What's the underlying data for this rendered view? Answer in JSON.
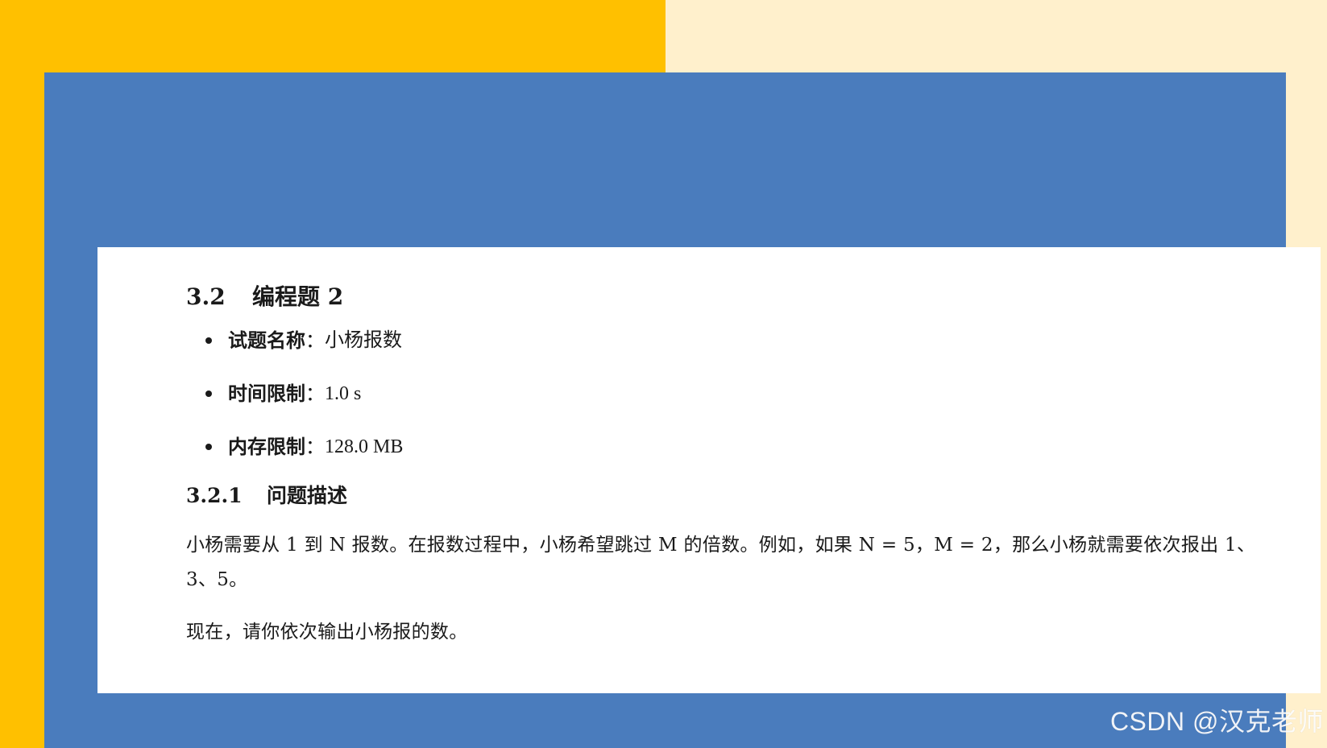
{
  "section": {
    "number": "3.2",
    "title": "编程题 2"
  },
  "meta": [
    {
      "key": "试题名称",
      "sep": "：",
      "value": "小杨报数"
    },
    {
      "key": "时间限制",
      "sep": "：",
      "value": "1.0 s"
    },
    {
      "key": "内存限制",
      "sep": "：",
      "value": "128.0 MB"
    }
  ],
  "subsection": {
    "number": "3.2.1",
    "title": "问题描述"
  },
  "paragraphs": [
    "小杨需要从 1 到 N 报数。在报数过程中，小杨希望跳过 M 的倍数。例如，如果 N = 5，M = 2，那么小杨就需要依次报出 1、3、5。",
    "现在，请你依次输出小杨报的数。"
  ],
  "watermark": "CSDN @汉克老师",
  "colors": {
    "left_background": "#ffc000",
    "right_background": "#fff0cc",
    "panel": "#4a7cbd",
    "card": "#ffffff"
  }
}
